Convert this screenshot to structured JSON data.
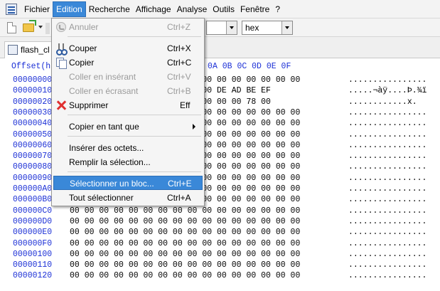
{
  "menubar": {
    "items": [
      "Fichier",
      "Edition",
      "Recherche",
      "Affichage",
      "Analyse",
      "Outils",
      "Fenêtre",
      "?"
    ],
    "active": "Edition"
  },
  "toolbar": {
    "combo_value": "hex"
  },
  "tab": {
    "title": "flash_cl"
  },
  "hex": {
    "header": "Offset(h) 00 01 02 03 04 05 06 07 08 09 0A 0B 0C 0D 0E 0F",
    "rows": [
      {
        "offset": "00000000",
        "bytes": "00 00 00 00 00 00 00 00 00 00 00 00 00 00 00 00",
        "ascii": "................"
      },
      {
        "offset": "00000010",
        "bytes": "00 00 00 00 00 00 00 00 00 00 DE AD BE EF",
        "ascii": ".....¬àÿ....Þ.¾ï"
      },
      {
        "offset": "00000020",
        "bytes": "00 00 00 00 00 00 00 00 00 00 00 00 78 00",
        "ascii": "............x."
      },
      {
        "offset": "00000030",
        "bytes": "00 00 00 00 00 00 00 00 00 00 00 00 00 00 00 00",
        "ascii": "................"
      },
      {
        "offset": "00000040",
        "bytes": "00 00 00 00 00 00 00 00 00 00 00 00 00 00 00 00",
        "ascii": "................"
      },
      {
        "offset": "00000050",
        "bytes": "00 00 00 00 00 00 00 00 00 00 00 00 00 00 00 00",
        "ascii": "................"
      },
      {
        "offset": "00000060",
        "bytes": "00 00 00 00 00 00 00 00 00 00 00 00 00 00 00 00",
        "ascii": "................"
      },
      {
        "offset": "00000070",
        "bytes": "00 00 00 00 00 00 00 00 00 00 00 00 00 00 00 00",
        "ascii": "................"
      },
      {
        "offset": "00000080",
        "bytes": "00 00 00 00 00 00 00 00 00 00 00 00 00 00 00 00",
        "ascii": "................"
      },
      {
        "offset": "00000090",
        "bytes": "00 00 00 00 00 00 00 00 00 00 00 00 00 00 00 00",
        "ascii": "................"
      },
      {
        "offset": "000000A0",
        "bytes": "00 00 00 00 00 00 00 00 00 00 00 00 00 00 00 00",
        "ascii": "................"
      },
      {
        "offset": "000000B0",
        "bytes": "00 00 00 00 00 00 00 00 00 00 00 00 00 00 00 00",
        "ascii": "................"
      },
      {
        "offset": "000000C0",
        "bytes": "00 00 00 00 00 00 00 00 00 00 00 00 00 00 00 00",
        "ascii": "................"
      },
      {
        "offset": "000000D0",
        "bytes": "00 00 00 00 00 00 00 00 00 00 00 00 00 00 00 00",
        "ascii": "................"
      },
      {
        "offset": "000000E0",
        "bytes": "00 00 00 00 00 00 00 00 00 00 00 00 00 00 00 00",
        "ascii": "................"
      },
      {
        "offset": "000000F0",
        "bytes": "00 00 00 00 00 00 00 00 00 00 00 00 00 00 00 00",
        "ascii": "................"
      },
      {
        "offset": "00000100",
        "bytes": "00 00 00 00 00 00 00 00 00 00 00 00 00 00 00 00",
        "ascii": "................"
      },
      {
        "offset": "00000110",
        "bytes": "00 00 00 00 00 00 00 00 00 00 00 00 00 00 00 00",
        "ascii": "................"
      },
      {
        "offset": "00000120",
        "bytes": "00 00 00 00 00 00 00 00 00 00 00 00 00 00 00 00",
        "ascii": "................"
      }
    ]
  },
  "edit_menu": {
    "undo": {
      "label": "Annuler",
      "shortcut": "Ctrl+Z"
    },
    "cut": {
      "label": "Couper",
      "shortcut": "Ctrl+X"
    },
    "copy": {
      "label": "Copier",
      "shortcut": "Ctrl+C"
    },
    "paste_insert": {
      "label": "Coller en insérant",
      "shortcut": "Ctrl+V"
    },
    "paste_overwrite": {
      "label": "Coller en écrasant",
      "shortcut": "Ctrl+B"
    },
    "delete": {
      "label": "Supprimer",
      "shortcut": "Eff"
    },
    "copy_as": {
      "label": "Copier en tant que"
    },
    "insert_bytes": {
      "label": "Insérer des octets..."
    },
    "fill_selection": {
      "label": "Remplir la sélection..."
    },
    "select_block": {
      "label": "Sélectionner un bloc...",
      "shortcut": "Ctrl+E"
    },
    "select_all": {
      "label": "Tout sélectionner",
      "shortcut": "Ctrl+A"
    }
  },
  "colors": {
    "accent": "#3a88d8",
    "offset_text": "#1b2fd6"
  }
}
